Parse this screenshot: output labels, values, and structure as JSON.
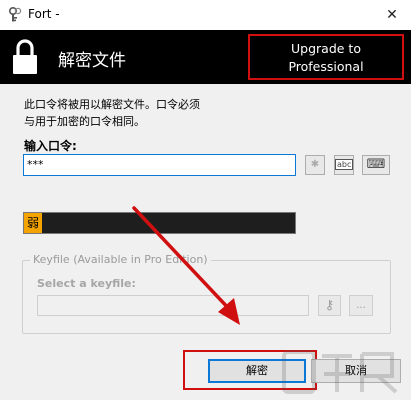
{
  "window": {
    "title": "Fort -",
    "close_glyph": "✕"
  },
  "header": {
    "title": "解密文件",
    "upgrade_label": "Upgrade to\nProfessional"
  },
  "description": "此口令将被用以解密文件。口令必须\n与用于加密的口令相同。",
  "password": {
    "label": "输入口令:",
    "value": "***",
    "tools": [
      {
        "icon": "asterisk-icon",
        "glyph": "✱"
      },
      {
        "icon": "abc-icon",
        "glyph": "abc"
      },
      {
        "icon": "keyboard-icon",
        "glyph": "⌨"
      }
    ]
  },
  "strength": {
    "label": "弱",
    "color": "#f5a300"
  },
  "keyfile": {
    "group_title": "Keyfile (Available in Pro Edition)",
    "select_label": "Select a keyfile:",
    "browse_label": "...",
    "key_glyph": "⚷"
  },
  "buttons": {
    "decrypt": "解密",
    "cancel": "取消"
  },
  "colors": {
    "highlight": "#d01010",
    "accent": "#0a78d7",
    "header_bg": "#000000"
  }
}
